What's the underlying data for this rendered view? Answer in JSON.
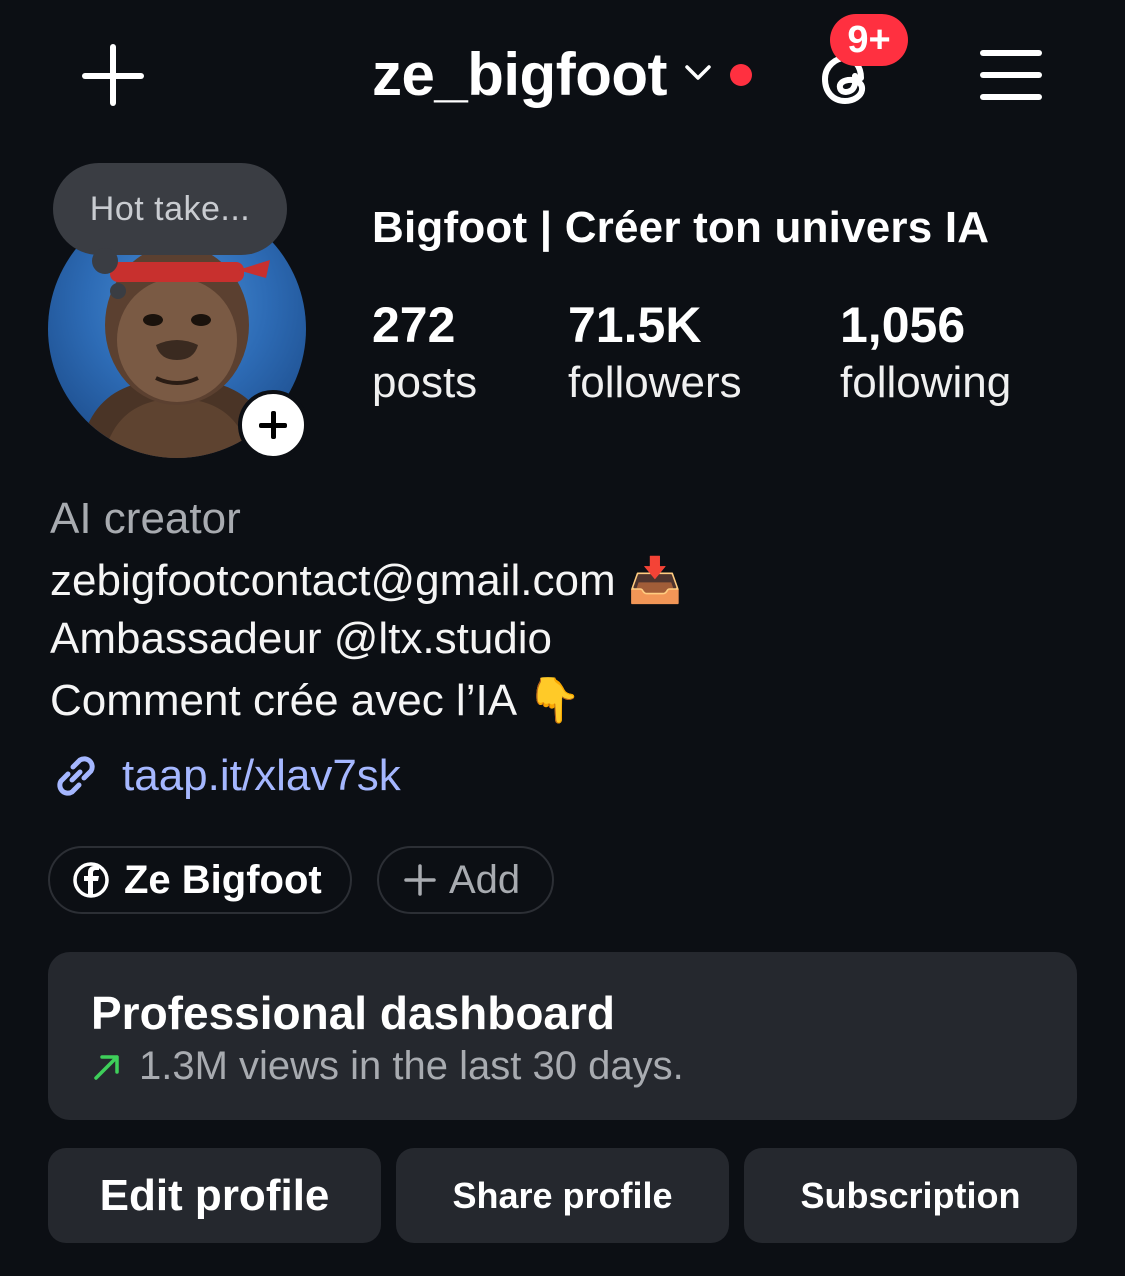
{
  "header": {
    "username": "ze_bigfoot",
    "notification_badge": "9+"
  },
  "avatar": {
    "note_text": "Hot take..."
  },
  "profile": {
    "display_name": "Bigfoot | Créer ton univers IA",
    "stats": [
      {
        "value": "272",
        "label": "posts"
      },
      {
        "value": "71.5K",
        "label": "followers"
      },
      {
        "value": "1,056",
        "label": "following"
      }
    ]
  },
  "bio": {
    "category": "AI creator",
    "lines": [
      "zebigfootcontact@gmail.com 📥",
      "Ambassadeur @ltx.studio",
      "Comment crée avec l’IA  👇"
    ],
    "link": "taap.it/xlav7sk"
  },
  "chips": {
    "facebook_label": "Ze Bigfoot",
    "add_label": "Add"
  },
  "dashboard": {
    "title": "Professional dashboard",
    "subtitle": "1.3M views in the last 30 days."
  },
  "buttons": {
    "edit": "Edit profile",
    "share": "Share profile",
    "subscription": "Subscription"
  },
  "colors": {
    "background": "#0c0f14",
    "surface": "#25282e",
    "accent_red": "#ff3040",
    "link_blue": "#a5b7ff",
    "trend_green": "#3ecf5a"
  }
}
